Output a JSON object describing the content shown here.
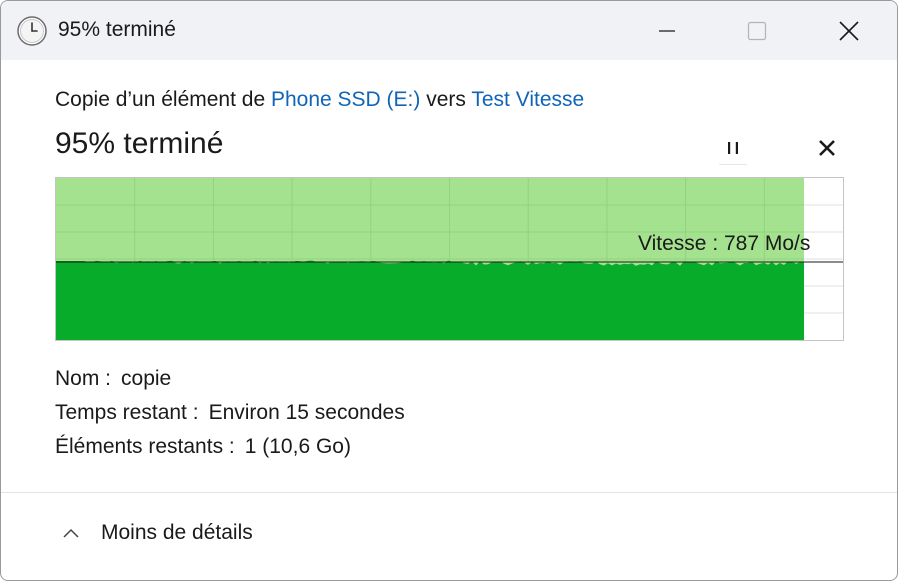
{
  "window": {
    "title": "95% terminé",
    "icons": {
      "app": "clock-icon",
      "minimize": "minimize-icon",
      "maximize": "maximize-icon",
      "close": "close-icon"
    }
  },
  "copy": {
    "prefix": "Copie d’un élément de ",
    "source": "Phone SSD (E:)",
    "middle": " vers ",
    "destination": "Test Vitesse",
    "status": "95% terminé",
    "progress_percent": 95,
    "speed_label": "Vitesse : 787 Mo/s"
  },
  "controls": {
    "pause_icon": "pause-icon",
    "cancel_icon": "cancel-x-icon"
  },
  "details": {
    "name_label": "Nom :",
    "name_value": "copie",
    "time_label": "Temps restant :",
    "time_value": "Environ 15 secondes",
    "items_label": "Éléments restants :",
    "items_value": "1 (10,6 Go)"
  },
  "footer": {
    "toggle_label": "Moins de détails",
    "toggle_icon": "chevron-up-icon"
  },
  "colors": {
    "progress_fill": "#a5e290",
    "speed_fill": "#07ad2a",
    "grid": "#8fd57a",
    "link": "#1065b8"
  }
}
